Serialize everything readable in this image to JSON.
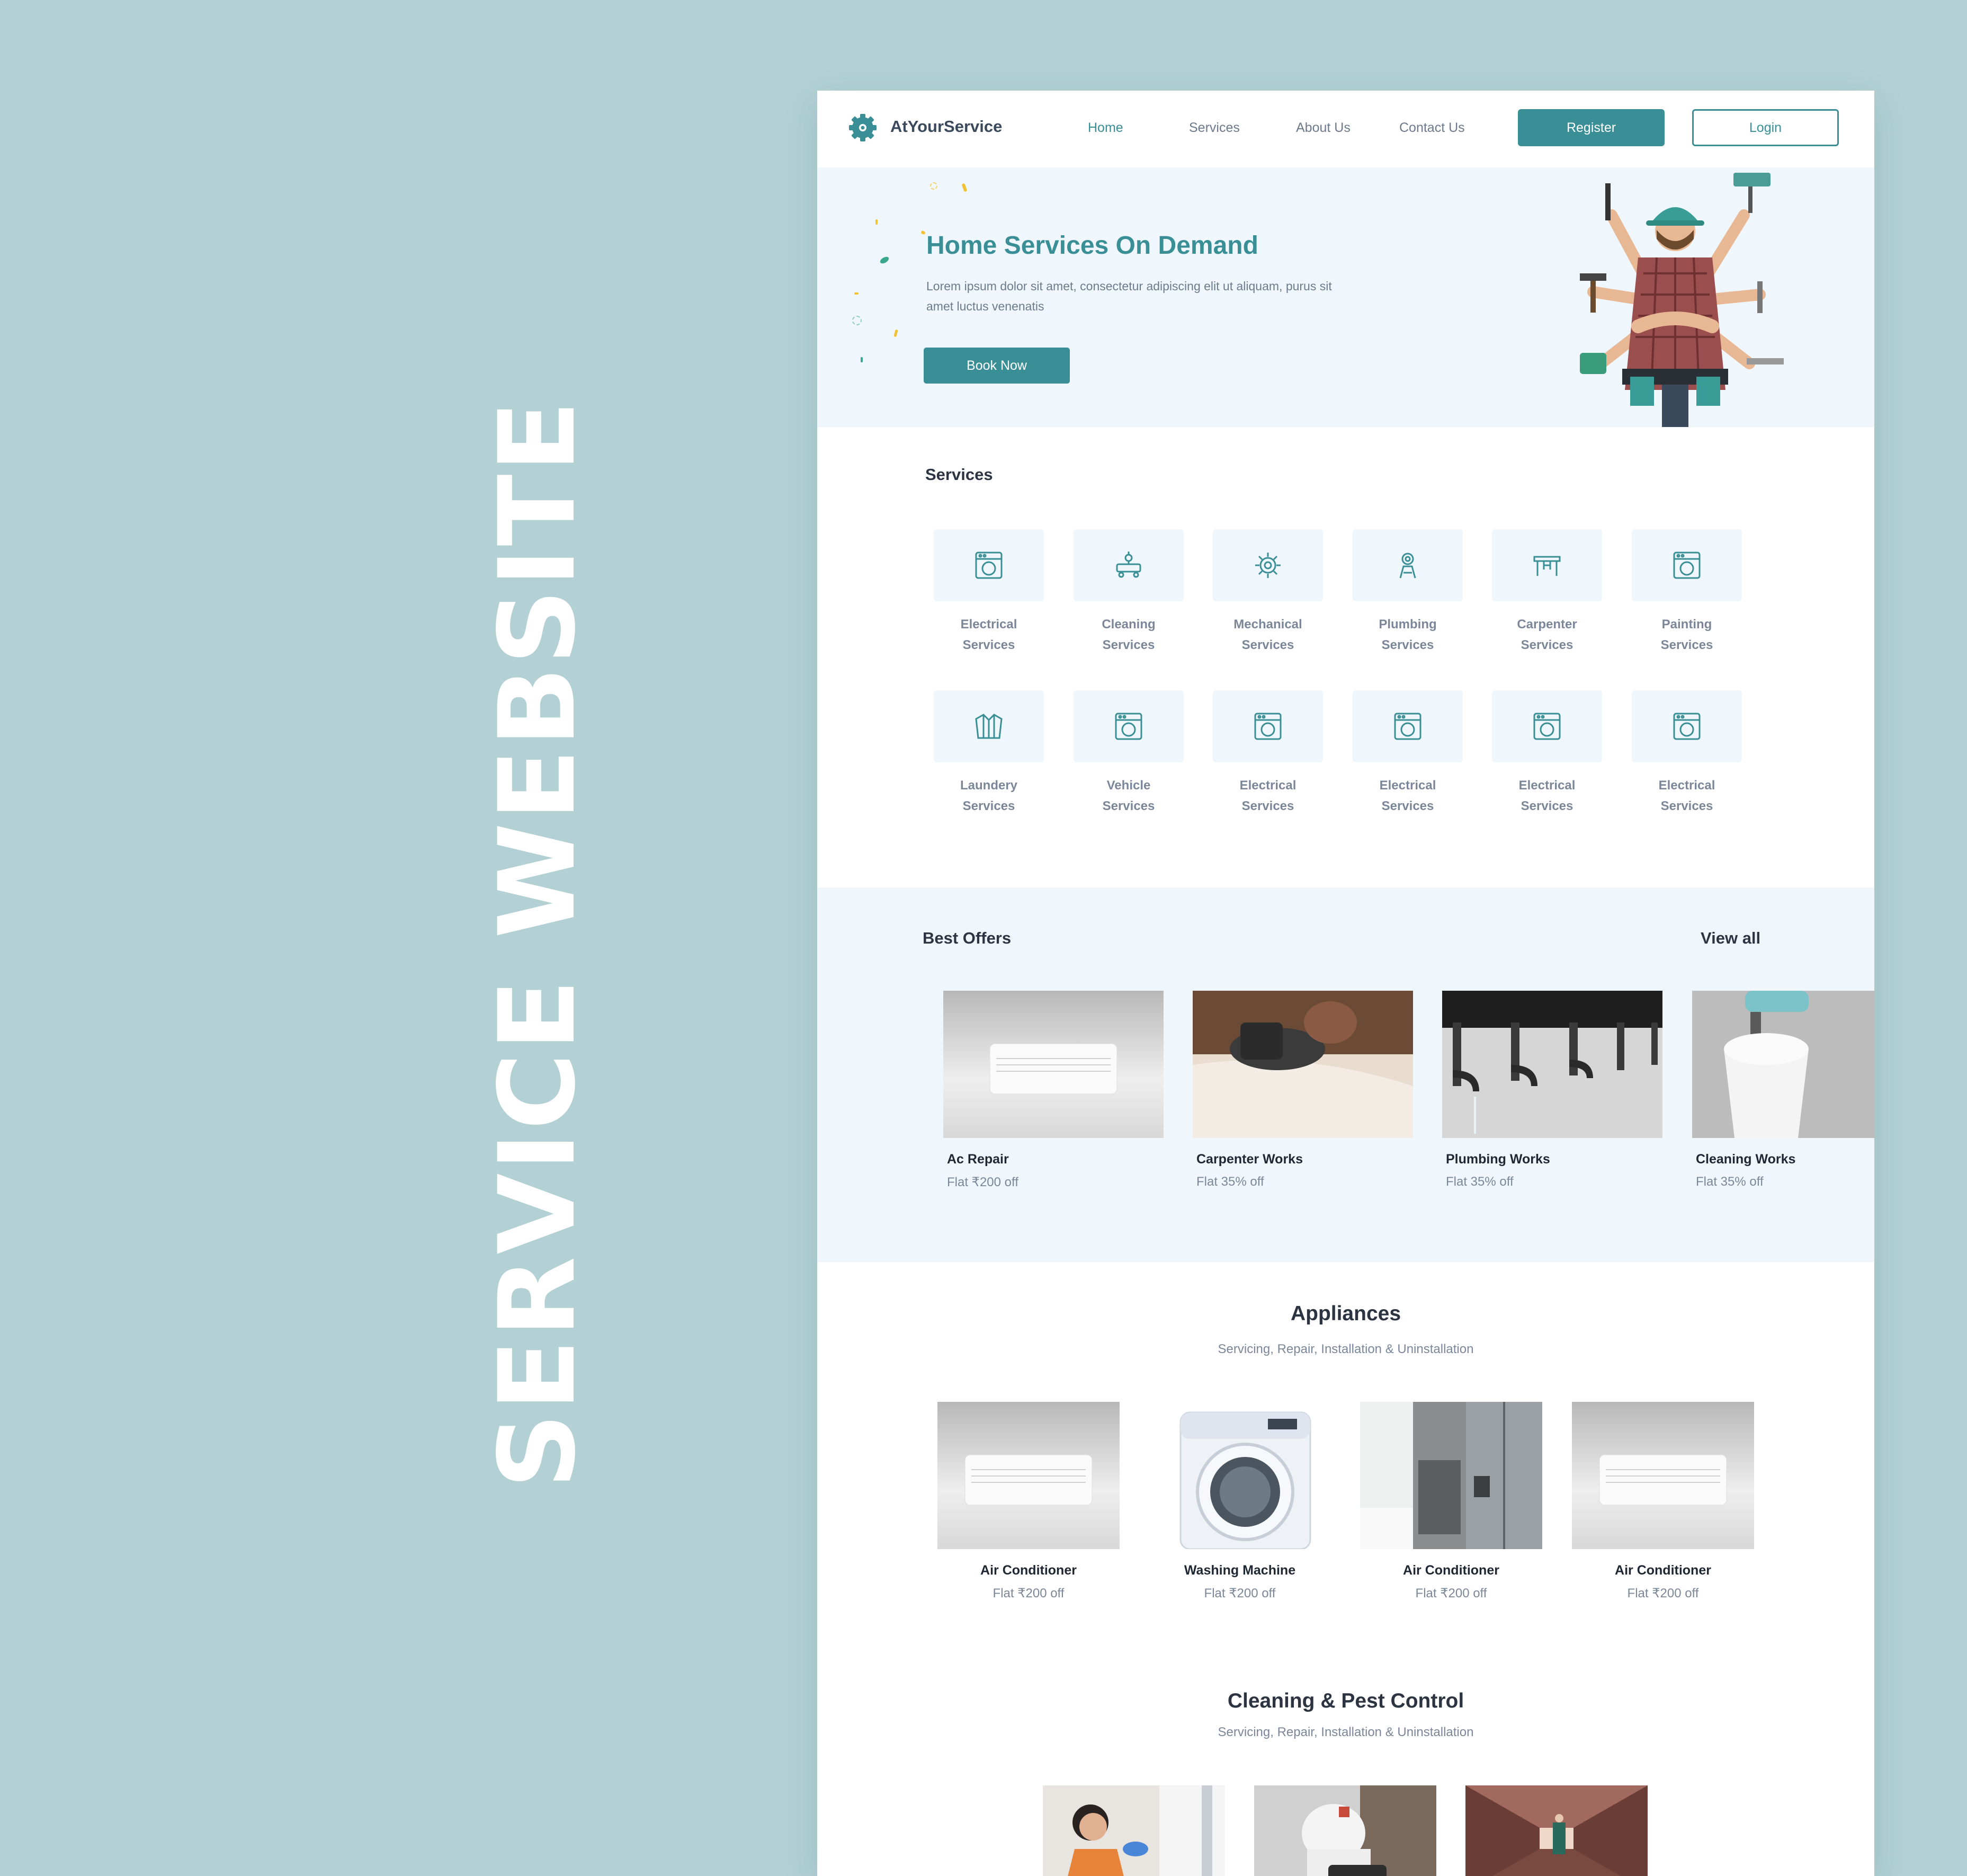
{
  "side_title": "SERVICE WEBSITE",
  "colors": {
    "accent": "#3a8f96",
    "light_bg": "#eff7fc",
    "outer_bg": "#b3d1d4"
  },
  "nav": {
    "brand": "AtYourService",
    "links": [
      "Home",
      "Services",
      "About Us",
      "Contact Us"
    ],
    "active": "Home",
    "register_label": "Register",
    "login_label": "Login"
  },
  "hero": {
    "title": "Home Services On Demand",
    "description": "Lorem ipsum dolor sit amet, consectetur adipiscing elit ut aliquam, purus sit amet luctus venenatis",
    "cta_label": "Book Now"
  },
  "services": {
    "title": "Services",
    "items": [
      {
        "line1": "Electrical",
        "line2": "Services",
        "icon": "washer-icon"
      },
      {
        "line1": "Cleaning",
        "line2": "Services",
        "icon": "cleaning-cart-icon"
      },
      {
        "line1": "Mechanical",
        "line2": "Services",
        "icon": "gear-icon"
      },
      {
        "line1": "Plumbing",
        "line2": "Services",
        "icon": "plumber-icon"
      },
      {
        "line1": "Carpenter",
        "line2": "Services",
        "icon": "table-icon"
      },
      {
        "line1": "Painting",
        "line2": "Services",
        "icon": "washer-icon"
      },
      {
        "line1": "Laundery",
        "line2": "Services",
        "icon": "shirt-icon"
      },
      {
        "line1": "Vehicle",
        "line2": "Services",
        "icon": "washer-icon"
      },
      {
        "line1": "Electrical",
        "line2": "Services",
        "icon": "washer-icon"
      },
      {
        "line1": "Electrical",
        "line2": "Services",
        "icon": "washer-icon"
      },
      {
        "line1": "Electrical",
        "line2": "Services",
        "icon": "washer-icon"
      },
      {
        "line1": "Electrical",
        "line2": "Services",
        "icon": "washer-icon"
      }
    ]
  },
  "offers": {
    "title": "Best Offers",
    "view_all": "View all",
    "items": [
      {
        "name": "Ac Repair",
        "sub": "Flat ₹200 off"
      },
      {
        "name": "Carpenter Works",
        "sub": "Flat 35% off"
      },
      {
        "name": "Plumbing Works",
        "sub": "Flat 35% off"
      },
      {
        "name": "Cleaning Works",
        "sub": "Flat 35% off"
      }
    ]
  },
  "appliances": {
    "title": "Appliances",
    "subtitle": "Servicing, Repair, Installation & Uninstallation",
    "items": [
      {
        "name": "Air Conditioner",
        "sub": "Flat ₹200 off"
      },
      {
        "name": "Washing Machine",
        "sub": "Flat ₹200 off"
      },
      {
        "name": "Air Conditioner",
        "sub": "Flat ₹200 off"
      },
      {
        "name": "Air Conditioner",
        "sub": "Flat ₹200 off"
      }
    ]
  },
  "cleaning": {
    "title": "Cleaning & Pest Control",
    "subtitle": "Servicing, Repair, Installation & Uninstallation"
  }
}
